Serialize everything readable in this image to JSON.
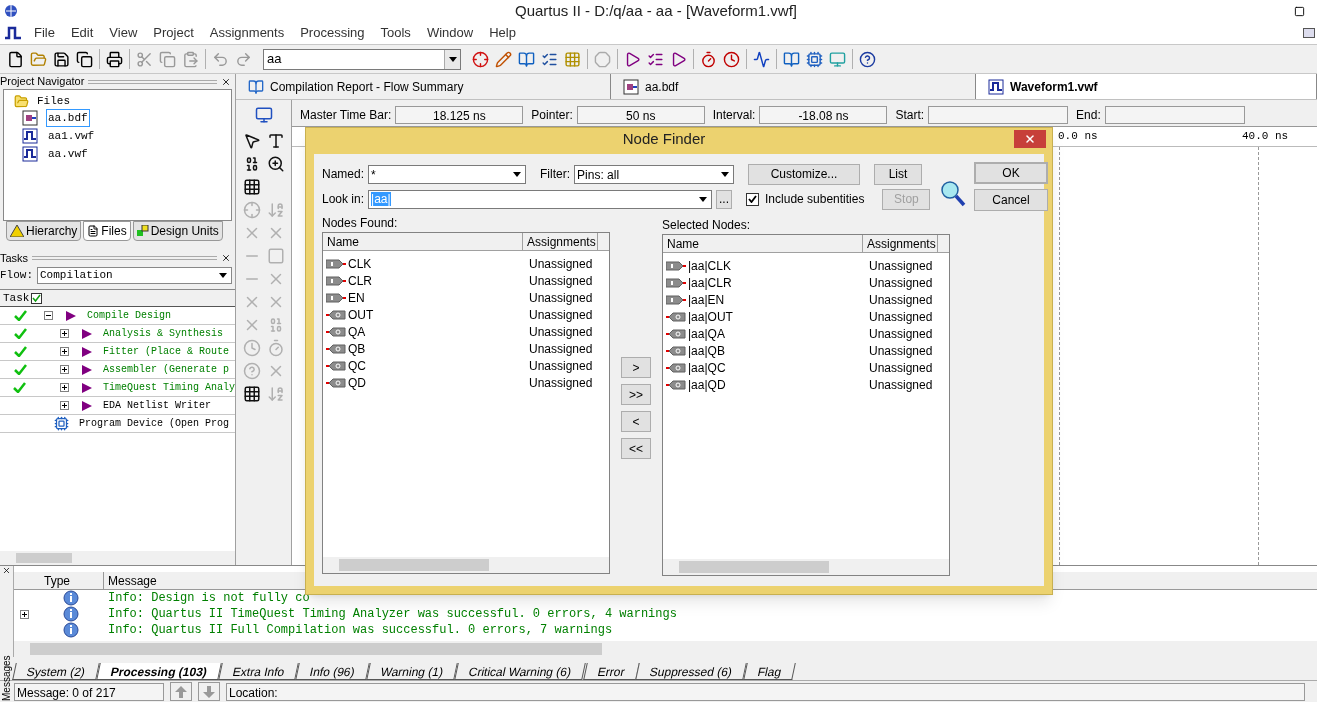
{
  "window": {
    "title": "Quartus II - D:/q/aa - aa - [Waveform1.vwf]"
  },
  "menu": [
    "File",
    "Edit",
    "View",
    "Project",
    "Assignments",
    "Processing",
    "Tools",
    "Window",
    "Help"
  ],
  "toolbar": {
    "project_combo": "aa"
  },
  "project_navigator": {
    "title": "Project Navigator",
    "tree": [
      {
        "label": "Files",
        "expanded": true,
        "children": [
          {
            "label": "aa.bdf",
            "kind": "bdf",
            "selected": true
          },
          {
            "label": "aa1.vwf",
            "kind": "vwf",
            "selected": false
          },
          {
            "label": "aa.vwf",
            "kind": "vwf",
            "selected": false
          }
        ]
      }
    ],
    "tabs": [
      {
        "label": "Hierarchy",
        "selected": false
      },
      {
        "label": "Files",
        "selected": true
      },
      {
        "label": "Design Units",
        "selected": false
      }
    ]
  },
  "tasks": {
    "title": "Tasks",
    "flow_label": "Flow:",
    "flow": "Compilation",
    "column": "Task",
    "items": [
      {
        "label": "Compile Design",
        "kind": "flow",
        "done": true,
        "expanded": true,
        "children": [
          {
            "label": "Analysis & Synthesis",
            "kind": "flow",
            "done": true,
            "expanded": false
          },
          {
            "label": "Fitter (Place & Route",
            "kind": "flow",
            "done": true,
            "expanded": false
          },
          {
            "label": "Assembler (Generate p",
            "kind": "flow",
            "done": true,
            "expanded": false
          },
          {
            "label": "TimeQuest Timing Analy",
            "kind": "flow",
            "done": true,
            "expanded": false
          },
          {
            "label": "EDA Netlist Writer",
            "kind": "flow",
            "done": false,
            "expanded": false
          }
        ]
      },
      {
        "label": "Program Device (Open Prog",
        "kind": "program",
        "done": false
      }
    ]
  },
  "doc_tabs": [
    {
      "label": "Compilation Report - Flow Summary",
      "kind": "report",
      "selected": false
    },
    {
      "label": "aa.bdf",
      "kind": "bdf",
      "selected": false
    },
    {
      "label": "Waveform1.vwf",
      "kind": "vwf",
      "selected": true
    }
  ],
  "waveform": {
    "fields": [
      {
        "label": "Master Time Bar:",
        "value": "18.125 ns"
      },
      {
        "label": "Pointer:",
        "value": "50 ns"
      },
      {
        "label": "Interval:",
        "value": "-18.08 ns"
      },
      {
        "label": "Start:"
      },
      {
        "label": "End:"
      }
    ],
    "ruler": [
      "0.0 ns",
      "40.0 ns"
    ]
  },
  "node_finder": {
    "title": "Node Finder",
    "named_label": "Named:",
    "named": "*",
    "filter_label": "Filter:",
    "filter": "Pins: all",
    "look_in_label": "Look in:",
    "look_in": "|aa|",
    "browse": "...",
    "include_subentities": {
      "label": "Include subentities",
      "checked": true
    },
    "buttons": [
      {
        "label": "Customize...",
        "disabled": false
      },
      {
        "label": "List",
        "disabled": false
      },
      {
        "label": "Stop",
        "disabled": true
      }
    ],
    "ok": "OK",
    "cancel": "Cancel",
    "nodes_found": {
      "title": "Nodes Found:",
      "columns": [
        "Name",
        "Assignments"
      ],
      "rows": [
        {
          "name": "CLK",
          "assignments": "Unassigned",
          "kind": "input"
        },
        {
          "name": "CLR",
          "assignments": "Unassigned",
          "kind": "input"
        },
        {
          "name": "EN",
          "assignments": "Unassigned",
          "kind": "input"
        },
        {
          "name": "OUT",
          "assignments": "Unassigned",
          "kind": "output"
        },
        {
          "name": "QA",
          "assignments": "Unassigned",
          "kind": "output"
        },
        {
          "name": "QB",
          "assignments": "Unassigned",
          "kind": "output"
        },
        {
          "name": "QC",
          "assignments": "Unassigned",
          "kind": "output"
        },
        {
          "name": "QD",
          "assignments": "Unassigned",
          "kind": "output"
        }
      ]
    },
    "transfer_buttons": [
      ">",
      ">>",
      "<",
      "<<"
    ],
    "selected_nodes": {
      "title": "Selected Nodes:",
      "columns": [
        "Name",
        "Assignments"
      ],
      "rows": [
        {
          "name": "|aa|CLK",
          "assignments": "Unassigned",
          "kind": "input"
        },
        {
          "name": "|aa|CLR",
          "assignments": "Unassigned",
          "kind": "input"
        },
        {
          "name": "|aa|EN",
          "assignments": "Unassigned",
          "kind": "input"
        },
        {
          "name": "|aa|OUT",
          "assignments": "Unassigned",
          "kind": "output"
        },
        {
          "name": "|aa|QA",
          "assignments": "Unassigned",
          "kind": "output"
        },
        {
          "name": "|aa|QB",
          "assignments": "Unassigned",
          "kind": "output"
        },
        {
          "name": "|aa|QC",
          "assignments": "Unassigned",
          "kind": "output"
        },
        {
          "name": "|aa|QD",
          "assignments": "Unassigned",
          "kind": "output"
        }
      ]
    }
  },
  "messages": {
    "side_label": "Messages",
    "columns": [
      "Type",
      "Message"
    ],
    "rows": [
      {
        "text": "Info: Design is not fully co",
        "expandable": false
      },
      {
        "text": "Info: Quartus II TimeQuest Timing Analyzer was successful. 0 errors, 4 warnings",
        "expandable": true
      },
      {
        "text": "Info: Quartus II Full Compilation was successful. 0 errors, 7 warnings",
        "expandable": false
      }
    ],
    "tabs": [
      {
        "label": "System (2)",
        "selected": false
      },
      {
        "label": "Processing (103)",
        "selected": true
      },
      {
        "label": "Extra Info",
        "selected": false
      },
      {
        "label": "Info (96)",
        "selected": false
      },
      {
        "label": "Warning (1)",
        "selected": false
      },
      {
        "label": "Critical Warning (6)",
        "selected": false
      },
      {
        "label": "Error",
        "selected": false
      },
      {
        "label": "Suppressed (6)",
        "selected": false
      },
      {
        "label": "Flag",
        "selected": false
      }
    ]
  },
  "status_bar": {
    "message": "Message: 0 of 217",
    "location_label": "Location:"
  }
}
